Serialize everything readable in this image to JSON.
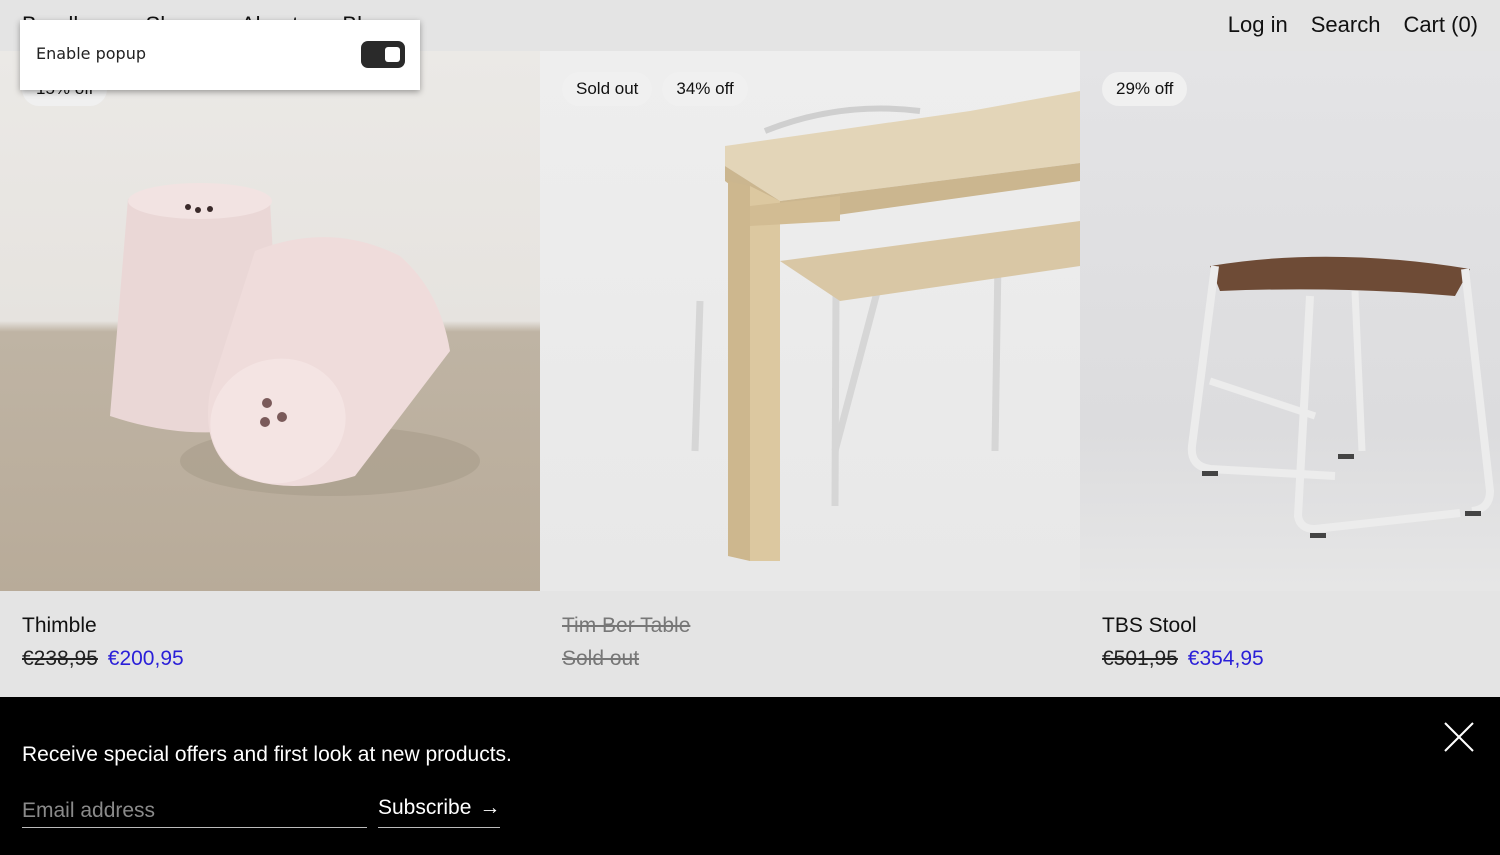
{
  "header": {
    "nav_left": [
      "Bundles",
      "Shop",
      "About",
      "Blog"
    ],
    "nav_right": {
      "login": "Log in",
      "search": "Search",
      "cart": "Cart (0)"
    }
  },
  "popup_panel": {
    "label": "Enable popup",
    "toggle_on": true
  },
  "products": [
    {
      "name": "Thimble",
      "badges": [
        "15% off"
      ],
      "compare_price": "€238,95",
      "price": "€200,95",
      "sold_out": false
    },
    {
      "name": "Tim Ber Table",
      "badges": [
        "Sold out",
        "34% off"
      ],
      "status": "Sold out",
      "sold_out": true
    },
    {
      "name": "TBS Stool",
      "badges": [
        "29% off"
      ],
      "compare_price": "€501,95",
      "price": "€354,95",
      "sold_out": false
    }
  ],
  "newsletter": {
    "message": "Receive special offers and first look at new products.",
    "email_placeholder": "Email address",
    "subscribe_label": "Subscribe",
    "subscribe_arrow": "→",
    "close_icon": "close-icon"
  },
  "colors": {
    "sale_price": "#2a1fd8",
    "newsletter_bg": "#000000",
    "page_bg": "#e4e4e4"
  }
}
